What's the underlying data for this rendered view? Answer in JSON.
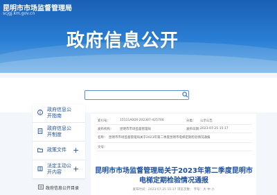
{
  "header": {
    "site_title": "昆明市市场监督管理局",
    "domain": "scjgj.km.gov.cn",
    "banner": "政府信息公开"
  },
  "search": {
    "placeholder": "",
    "icon": "search-icon"
  },
  "sidebar": {
    "items": [
      {
        "label": "政府信息公开指南",
        "icon": "info-icon",
        "expandable": false
      },
      {
        "label": "政府信息公开制度",
        "icon": "document-icon",
        "expandable": false
      },
      {
        "label": "政策文件",
        "icon": "folder-icon",
        "expandable": true,
        "toggle": "+"
      },
      {
        "label": "法定主动公开内容",
        "icon": "book-icon",
        "expandable": true,
        "toggle": "+"
      }
    ],
    "footer": {
      "label": "政府信息公开目录",
      "icon": "catalog-icon"
    }
  },
  "meta": {
    "index_label": "索引号：",
    "index_value": "15111A00X-202307-425700",
    "category_label": "分类：",
    "category_value": "公示公告",
    "org_label": "发布机构：",
    "org_value": "昆明市市场监督管理局",
    "date_label": "发布日期：",
    "date_value": "2023-07-25 15:17",
    "name_label": "名称：",
    "name_value": "昆明市市场监督管理局关于2023年第二季度昆明市电梯定期检验情况通报",
    "docno_label": "文号："
  },
  "article": {
    "title": "昆明市市场监督管理局关于2023年第二季度昆明市电梯定期检验情况通报",
    "meta_line": "发布时间：2023-07-25 15:17  浏览次数：  字号：大 中 小"
  },
  "colors": {
    "primary": "#1f4f98",
    "banner_blue": "#2a7fd4",
    "background": "#f3f6fa"
  }
}
